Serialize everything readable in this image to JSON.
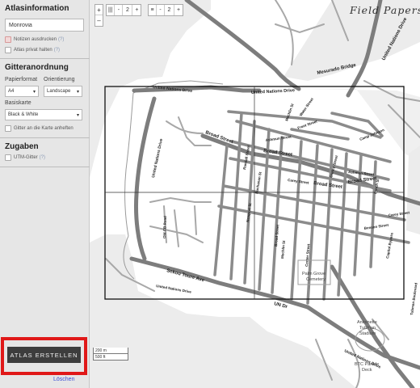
{
  "sidebar": {
    "atlas_info": {
      "title": "Atlasinformation",
      "name_value": "Monrovia",
      "print_notes_label": "Notizen ausdrucken",
      "private_label": "Atlas privat halten",
      "help": "(?)"
    },
    "grid": {
      "title": "Gitteranordnung",
      "paper_label": "Papierformat",
      "orientation_label": "Orientierung",
      "paper_value": "A4",
      "orientation_value": "Landscape",
      "basemap_label": "Basiskarte",
      "basemap_value": "Black & White",
      "fit_grid_label": "Gitter an die Karte anheften"
    },
    "extras": {
      "title": "Zugaben",
      "utm_label": "UTM-Gitter",
      "help": "(?)"
    },
    "make_atlas_label": "ATLAS ERSTELLEN",
    "delete_label": "Löschen"
  },
  "map": {
    "brand": "Field Papers",
    "zoom": {
      "in": "+",
      "out": "–"
    },
    "cols_control": {
      "icon": "|||",
      "minus": "-",
      "value": "2",
      "plus": "+"
    },
    "rows_control": {
      "icon": "≡",
      "minus": "-",
      "value": "2",
      "plus": "+"
    },
    "scale_metric": "200 m",
    "scale_imperial": "500 ft",
    "labels": {
      "mesurado_bridge": "Mesurado Bridge",
      "un_drive_top": "United Nations Drive",
      "un_drive_left": "United Nations Drive",
      "un_drive_vertical": "United Nations Drive",
      "un_drive_right": "United Nations Drive",
      "un_drive_bottom": "United Nations Drive",
      "un_drive_bottom2": "United Nations Drive",
      "broad_street_1": "Broad Street",
      "broad_street_2": "Broad Street",
      "broad_street_3": "Broad Street",
      "broad_street_4": "Broad Street",
      "ashmun_street_1": "Ashmun Street",
      "ashmun_street_2": "Ashmun Street",
      "camp_johnson": "Camp Johnson",
      "carey_street_1": "Carey Street",
      "carey_street_2": "Carey Street",
      "gurley_street": "Gurley Street",
      "benson_street": "Benson Street",
      "water_street": "Water Street",
      "front_street": "Front Street",
      "mechlin_st": "Mechlin St",
      "randall_street": "Randall Street",
      "buchanan_st": "Buchanan St",
      "newport_st": "Newport St",
      "old_cb_road": "Old CB Road",
      "center_street": "Center Street",
      "broad_st_vert": "Broad Street",
      "sekou_toure_ave": "Sekou Toure Ave",
      "palm_grove": "Palm Grove\nCemetery",
      "un_dr": "UN Dr",
      "antoinette": "Antoinette\nTubman\nStadium",
      "btc_parade": "BTC Parade\nDeck",
      "tubman_blvd": "Tubman Boulevard",
      "lynch_st": "Lynch St",
      "capitol_bypass": "Capitol Bypass"
    }
  }
}
